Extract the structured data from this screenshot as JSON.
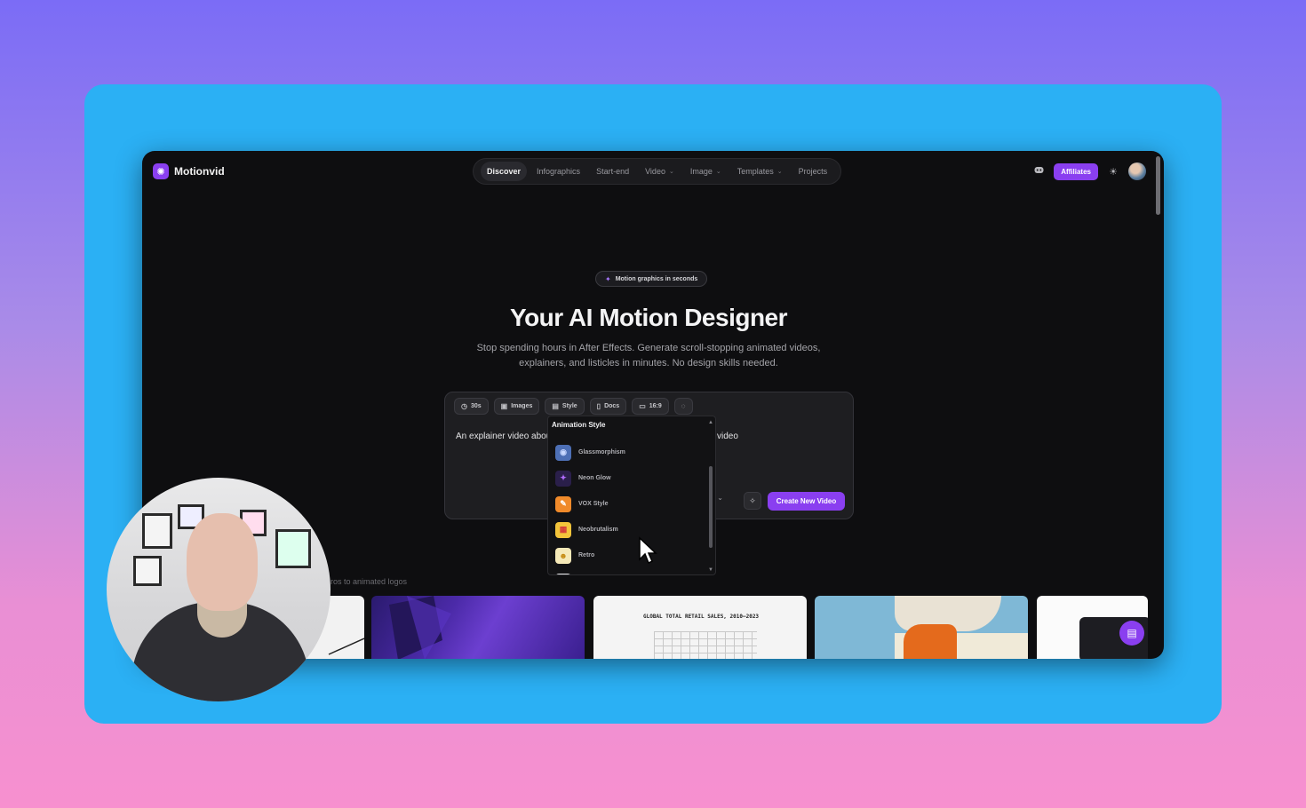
{
  "app": {
    "name": "Motionvid",
    "logo_glyph": "✺"
  },
  "nav": {
    "items": [
      {
        "label": "Discover",
        "active": true,
        "dropdown": false
      },
      {
        "label": "Infographics",
        "active": false,
        "dropdown": false
      },
      {
        "label": "Start-end",
        "active": false,
        "dropdown": false
      },
      {
        "label": "Video",
        "active": false,
        "dropdown": true
      },
      {
        "label": "Image",
        "active": false,
        "dropdown": true
      },
      {
        "label": "Templates",
        "active": false,
        "dropdown": true
      },
      {
        "label": "Projects",
        "active": false,
        "dropdown": false
      }
    ]
  },
  "header": {
    "discord_icon": "discord-icon",
    "affiliates_label": "Affiliates",
    "theme_icon": "sun-icon",
    "avatar": "user-avatar"
  },
  "hero": {
    "badge": "Motion graphics in seconds",
    "title": "Your AI Motion Designer",
    "subtitle_line1": "Stop spending hours in After Effects. Generate scroll-stopping animated videos,",
    "subtitle_line2": "explainers, and listicles in minutes. No design skills needed."
  },
  "composer": {
    "chips": [
      {
        "icon": "clock-icon",
        "glyph": "◷",
        "label": "30s"
      },
      {
        "icon": "image-icon",
        "glyph": "▣",
        "label": "Images"
      },
      {
        "icon": "style-icon",
        "glyph": "▤",
        "label": "Style"
      },
      {
        "icon": "doc-icon",
        "glyph": "▯",
        "label": "Docs"
      },
      {
        "icon": "monitor-icon",
        "glyph": "▭",
        "label": "16:9"
      },
      {
        "icon": "palette-icon",
        "glyph": "◌",
        "label": ""
      }
    ],
    "prompt_left": "An explainer video abou",
    "prompt_right": "video",
    "select_fragment": "s",
    "create_label": "Create New Video"
  },
  "dropdown": {
    "title": "Animation Style",
    "items": [
      {
        "label": "Glassmorphism",
        "color": "#4d6fb5",
        "glyph": "◉"
      },
      {
        "label": "Neon Glow",
        "color": "#2a1f4a",
        "glyph": "✦"
      },
      {
        "label": "VOX Style",
        "color": "#f08a2a",
        "glyph": "✎"
      },
      {
        "label": "Neobrutalism",
        "color": "#f3c43b",
        "glyph": "▦"
      },
      {
        "label": "Retro",
        "color": "#f5e9b8",
        "glyph": "☻"
      }
    ]
  },
  "gallery": {
    "caption": "ros to animated logos",
    "chart_title": "GLOBAL TOTAL RETAIL SALES, 2010—2023"
  },
  "chat": {
    "icon": "chat-icon"
  }
}
